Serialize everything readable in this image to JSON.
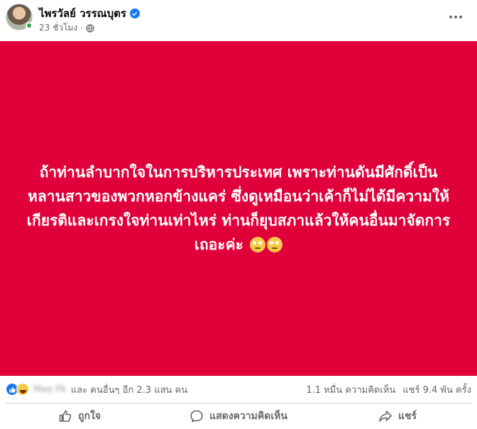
{
  "post": {
    "author": "ไพรวัลย์ วรรณบุตร",
    "time": "23 ชั่วโมง",
    "separator": "·",
    "text": "ถ้าท่านลำบากใจในการบริหารประเทศ  เพราะท่านดันมีศักดิ์เป็นหลานสาวของพวกหอกข้างแคร่   ซึ่งดูเหมือนว่าเค้าก็ไม่ได้มีความให้เกียรติและเกรงใจท่านเท่าไหร่ ท่านก็ยุบสภาแล้วให้คนอื่นมาจัดการเถอะค่ะ",
    "background_color": "#e0003a",
    "emojis": [
      "face-with-rolling-eyes",
      "face-with-rolling-eyes"
    ]
  },
  "stats": {
    "blurred_name": "Mee Pk",
    "others": "และ คนอื่นๆ อีก 2.3 แสน คน",
    "comments": "1.1 หมื่น ความคิดเห็น",
    "shares": "แชร์ 9.4 พัน ครั้ง"
  },
  "actions": {
    "like": "ถูกใจ",
    "comment": "แสดงความคิดเห็น",
    "share": "แชร์"
  },
  "icons": {
    "verified": "verified-badge-icon",
    "audience": "globe-icon",
    "more": "more-options-icon"
  },
  "colors": {
    "accent": "#1877f2",
    "muted_text": "#65676b"
  }
}
